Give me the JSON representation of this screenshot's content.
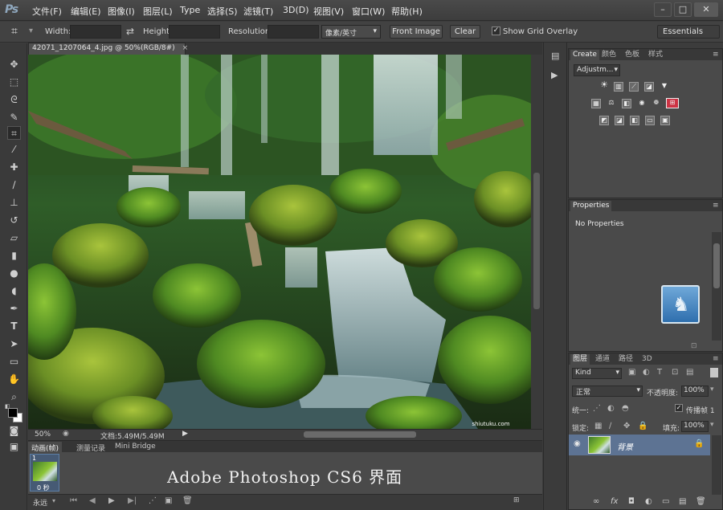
{
  "app": {
    "logo": "Ps"
  },
  "menu": [
    "文件(F)",
    "编辑(E)",
    "图像(I)",
    "图层(L)",
    "Type",
    "选择(S)",
    "滤镜(T)",
    "3D(D)",
    "视图(V)",
    "窗口(W)",
    "帮助(H)"
  ],
  "window_controls": {
    "minimize": "–",
    "restore": "□",
    "close": "✕"
  },
  "options": {
    "width_label": "Width:",
    "height_label": "Height:",
    "resolution_label": "Resolution:",
    "unit_value": "像素/英寸",
    "front_image": "Front Image",
    "clear": "Clear",
    "grid_overlay": "Show Grid Overlay",
    "workspace": "Essentials"
  },
  "document": {
    "tab_title": "42071_1207064_4.jpg @ 50%(RGB/8#)",
    "zoom": "50%",
    "doc_size": "文档:5.49M/5.49M",
    "watermark": "shiutuku.com"
  },
  "timeline": {
    "tabs": [
      "动画(帧)",
      "测量记录",
      "Mini Bridge"
    ],
    "frame_number": "1",
    "frame_delay": "0 秒",
    "loop": "永远",
    "caption": "Adobe Photoshop CS6 界面"
  },
  "adjustments": {
    "tabs": [
      "Create",
      "颜色",
      "色板",
      "样式"
    ],
    "preset": "Adjustm..."
  },
  "properties": {
    "title": "Properties",
    "body": "No Properties"
  },
  "layers": {
    "tabs": [
      "图层",
      "通道",
      "路径",
      "3D"
    ],
    "filter": "Kind",
    "blend": "正常",
    "opacity_label": "不透明度:",
    "opacity": "100%",
    "unify_label": "统一:",
    "propagate": "传播帧 1",
    "lock_label": "锁定:",
    "fill_label": "填充:",
    "fill": "100%",
    "items": [
      {
        "name": "背景"
      }
    ],
    "footer": [
      "∞",
      "fx",
      "◘",
      "◐",
      "▭",
      "▤",
      "🗑"
    ]
  },
  "colors": {
    "accent": "#5d7393",
    "background": "#3c3c3c",
    "panel": "#4a4a4a"
  }
}
